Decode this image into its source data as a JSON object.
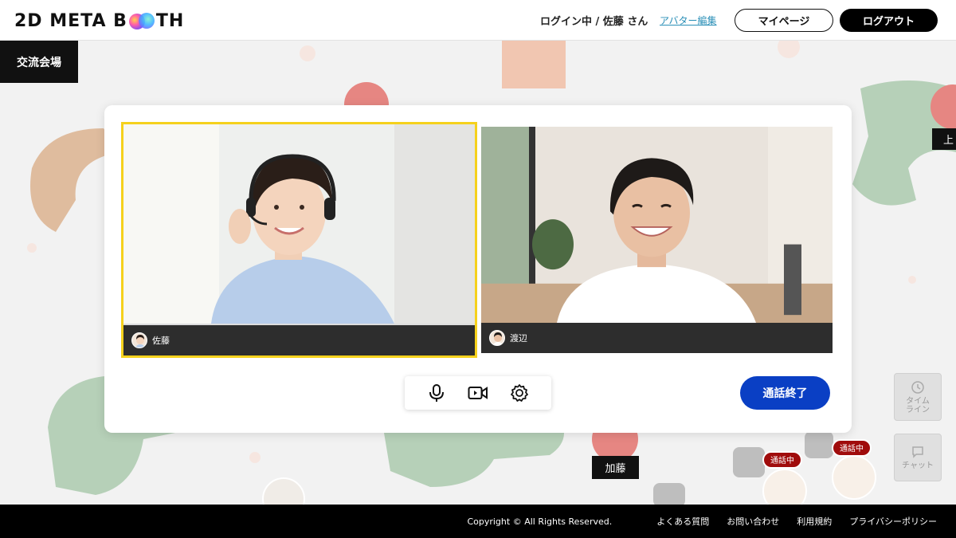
{
  "header": {
    "logo_text_left": "2D META B",
    "logo_text_right": "TH",
    "login_status": "ログイン中 / 佐藤 さん",
    "avatar_edit": "アバター編集",
    "mypage": "マイページ",
    "logout": "ログアウト"
  },
  "venue": {
    "hall_label": "交流会場",
    "name_tags": [
      "加藤",
      "上"
    ],
    "call_badges": [
      "通話中",
      "通話中"
    ],
    "side_buttons": [
      "タイムライン",
      "チャット"
    ]
  },
  "call": {
    "participants": [
      {
        "name": "佐藤",
        "active": true
      },
      {
        "name": "渡辺",
        "active": false
      }
    ],
    "controls": [
      "microphone-icon",
      "video-camera-icon",
      "settings-icon"
    ],
    "end_call": "通話終了"
  },
  "footer": {
    "copyright": "Copyright ©  All Rights Reserved.",
    "links": [
      "よくある質問",
      "お問い合わせ",
      "利用規約",
      "プライバシーポリシー"
    ]
  },
  "colors": {
    "accent_blue": "#0a3fc4",
    "active_outline": "#f5d11c",
    "call_badge": "#a00c0c",
    "link": "#2a8fb7"
  }
}
